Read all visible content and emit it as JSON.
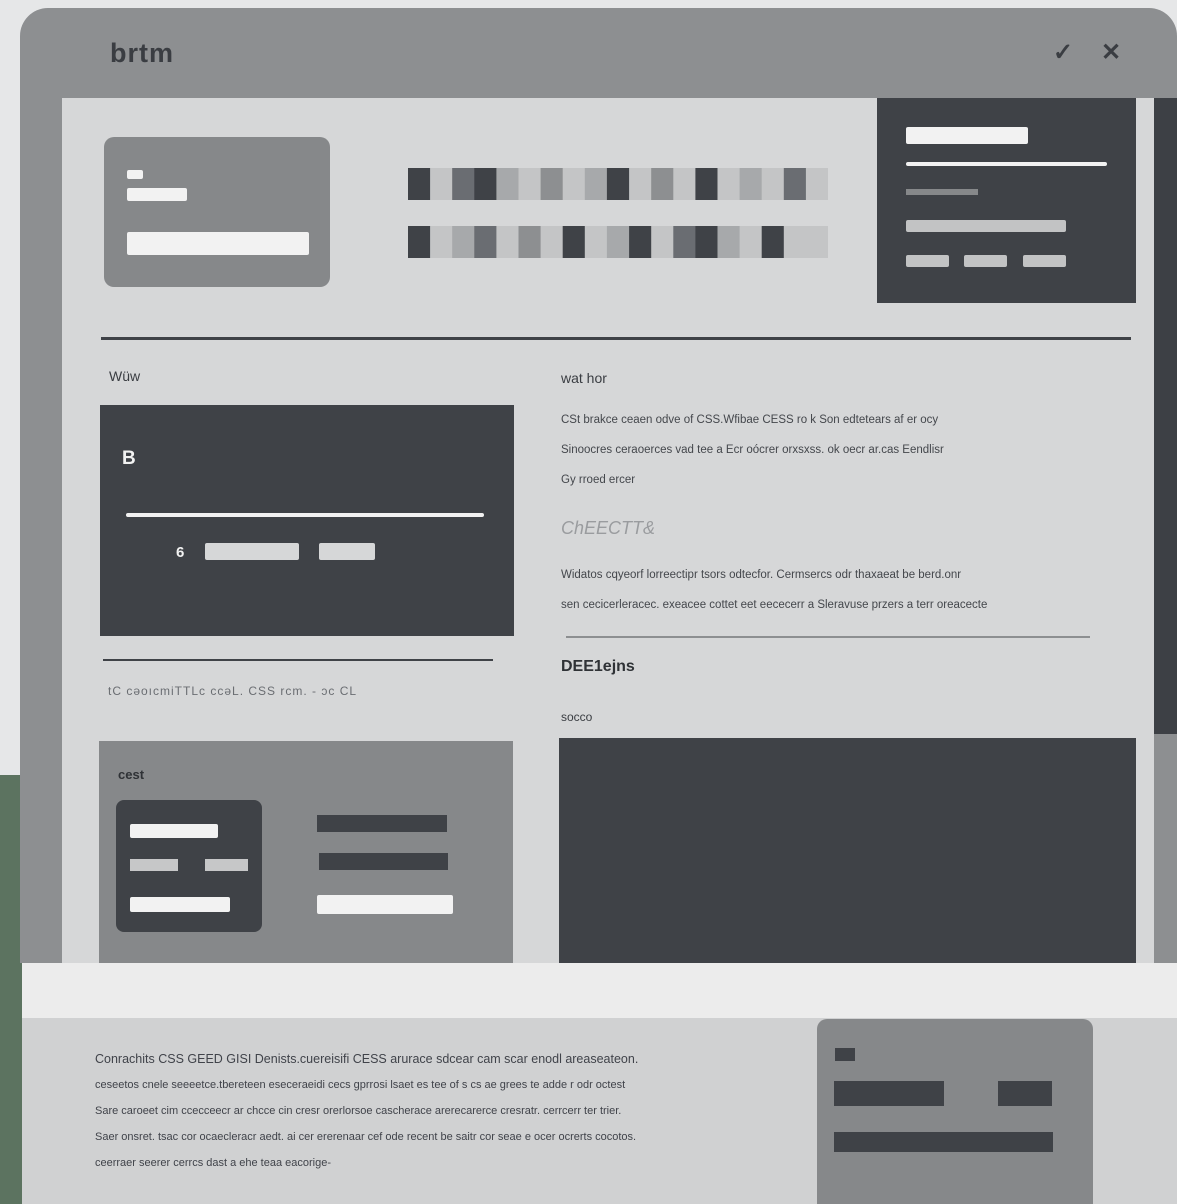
{
  "window": {
    "title": "brtm",
    "icons": [
      "wrench-icon",
      "close-icon"
    ]
  },
  "left_column": {
    "section_label": "Wüw",
    "dark_card_glyph": "B",
    "bullet_glyph": "6",
    "caption": "tC  cəoıcmiTTLc  ccəL.  CSS  rcm.  -  ɔc  CL",
    "card_label": "cest"
  },
  "right_column": {
    "section_label": "wat hor",
    "paragraph1": [
      "CSt brakce ceaen odve of CSS.Wfibae CESS ro k Son edtetears af er ocy",
      "Sinoocres ceraoerces vad tee a Ecr oócrer orxsxss. ok oecr ar.cas Eendlisr",
      "Gy rroed ercer"
    ],
    "subheading": "ChEECTT&",
    "paragraph2": [
      "Widatos cqyeorf lorreectipr tsors odtecfor. Cermsercs odr thaxaeat be berd.onr",
      "sen cecicerleracec. exeacee cottet eet eececerr a Sleravuse przers a terr oreacecte"
    ],
    "heading": "DEE1ejns",
    "small_label": "socco"
  },
  "footer": {
    "lines": [
      "Conrachits CSS GEED GISI Denists.cuereisifi CESS arurace sdcear cam scar enodl areaseateon.",
      "ceseetos cnele seeeetce.tbereteen eseceraeidi cecs gprrosi lsaet es tee of s cs ae grees te adde r odr octest",
      "Sare caroeet cim ccecceecr ar chcce cin cresr orerlorsoe cascherace arerecarerce cresratr. cerrcerr ter trier.",
      "Saer onsret. tsac cor ocaecleracr aedt. ai cer ererenaar cef ode recent be saitr cor seae e ocer ocrerts cocotos.",
      "ceerraer seerer cerrcs dast a ehe teaa eacorige-"
    ]
  },
  "colors": {
    "dark": "#3f4247",
    "mid_gray": "#86888a",
    "content_bg": "#d6d7d8",
    "accent_green": "#5c7360"
  }
}
